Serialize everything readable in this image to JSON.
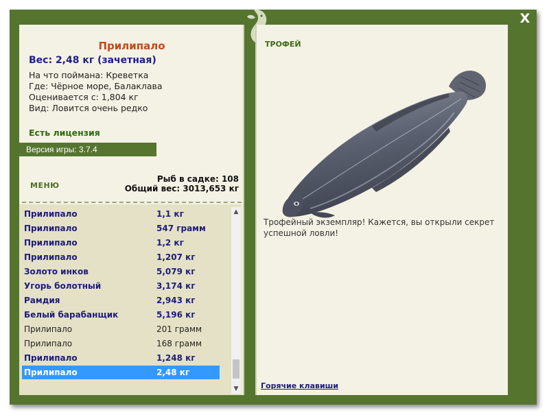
{
  "window": {
    "close_label": "X"
  },
  "details": {
    "name": "Прилипало",
    "weight_line": "Вес: 2,48 кг (зачетная)",
    "info_lines": [
      "На что поймана: Креветка",
      "Где: Чёрное море, Балаклава",
      "Оценивается с: 1,804 кг",
      "Вид: Ловится очень редко"
    ],
    "license": "Есть лицензия",
    "version": "Версия игры: 3.7.4"
  },
  "menu_label": "МЕНЮ",
  "stats": {
    "fish_in_keepnet": "Рыб в садке: 108",
    "total_weight": "Общий вес: 3013,653 кг"
  },
  "catch_list": [
    {
      "name": "Прилипало",
      "weight": "1,1 кг",
      "style": "bold"
    },
    {
      "name": "Прилипало",
      "weight": "547 грамм",
      "style": "bold"
    },
    {
      "name": "Прилипало",
      "weight": "1,2 кг",
      "style": "bold"
    },
    {
      "name": "Прилипало",
      "weight": "1,207 кг",
      "style": "bold"
    },
    {
      "name": "Золото инков",
      "weight": "5,079 кг",
      "style": "bold"
    },
    {
      "name": "Угорь болотный",
      "weight": "3,174 кг",
      "style": "bold"
    },
    {
      "name": "Рамдия",
      "weight": "2,943 кг",
      "style": "bold"
    },
    {
      "name": "Белый барабанщик",
      "weight": "5,196 кг",
      "style": "bold"
    },
    {
      "name": "Прилипало",
      "weight": "201 грамм",
      "style": "plain"
    },
    {
      "name": "Прилипало",
      "weight": "168 грамм",
      "style": "plain"
    },
    {
      "name": "Прилипало",
      "weight": "1,248 кг",
      "style": "bold"
    },
    {
      "name": "Прилипало",
      "weight": "2,48 кг",
      "style": "selected"
    }
  ],
  "trophy": {
    "title": "ТРОФЕЙ",
    "text": "Трофейный экземпляр! Кажется, вы открыли секрет успешной ловли!"
  },
  "hotkeys_label": "Горячие клавиши",
  "colors": {
    "frame": "#55752f",
    "panel": "#f4f2e4",
    "list_bg": "#e5e1c6",
    "selected_row": "#3399ff",
    "fish_name": "#c3491d",
    "bold_text": "#1c1c7a",
    "green_heading": "#3d6b17"
  }
}
